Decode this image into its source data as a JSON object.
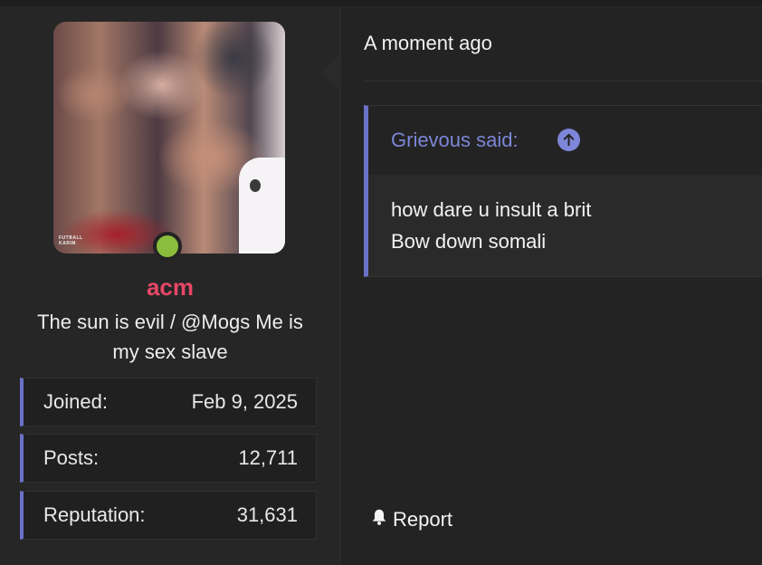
{
  "user": {
    "avatar_icon": "user-avatar-image",
    "avatar_watermark_line1": "FUTBALL",
    "avatar_watermark_line2": "KARIM",
    "online_status_color": "#8bbd3c",
    "username": "acm",
    "username_color": "#e74766",
    "title_line1": "The sun is evil / @Mogs Me is",
    "title_line2": "my sex slave",
    "stats": [
      {
        "label": "Joined:",
        "value": "Feb 9, 2025"
      },
      {
        "label": "Posts:",
        "value": "12,711"
      },
      {
        "label": "Reputation:",
        "value": "31,631"
      }
    ]
  },
  "post": {
    "timestamp": "A moment ago",
    "quote": {
      "author": "Grievous said:",
      "jump_icon": "arrow-up-circle-icon",
      "lines": [
        "how dare u insult a brit",
        "Bow down somali"
      ]
    },
    "report_icon": "bell-icon",
    "report_label": "Report"
  },
  "colors": {
    "accent": "#6a72c8",
    "quote_author": "#7d86d8",
    "background": "#232323"
  }
}
